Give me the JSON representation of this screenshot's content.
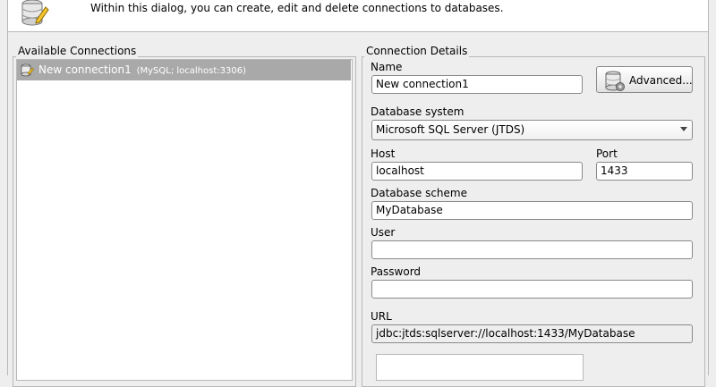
{
  "header": {
    "description": "Within this dialog, you can create, edit and delete connections to databases.",
    "icon": "database-edit-icon"
  },
  "connections": {
    "title": "Available Connections",
    "items": [
      {
        "name": "New connection1",
        "meta": "(MySQL; localhost:3306)",
        "icon": "database-icon",
        "selected": true
      }
    ]
  },
  "details": {
    "title": "Connection Details",
    "name_label": "Name",
    "name_value": "New connection1",
    "advanced_label": "Advanced...",
    "advanced_icon": "database-settings-icon",
    "dbsystem_label": "Database system",
    "dbsystem_value": "Microsoft SQL Server (JTDS)",
    "host_label": "Host",
    "host_value": "localhost",
    "port_label": "Port",
    "port_value": "1433",
    "scheme_label": "Database scheme",
    "scheme_value": "MyDatabase",
    "user_label": "User",
    "user_value": "",
    "password_label": "Password",
    "password_value": "",
    "url_label": "URL",
    "url_value": "jdbc:jtds:sqlserver://localhost:1433/MyDatabase"
  },
  "colors": {
    "selection": "#a9a9a9",
    "background": "#eeeeee",
    "border": "#b8b8b8"
  }
}
